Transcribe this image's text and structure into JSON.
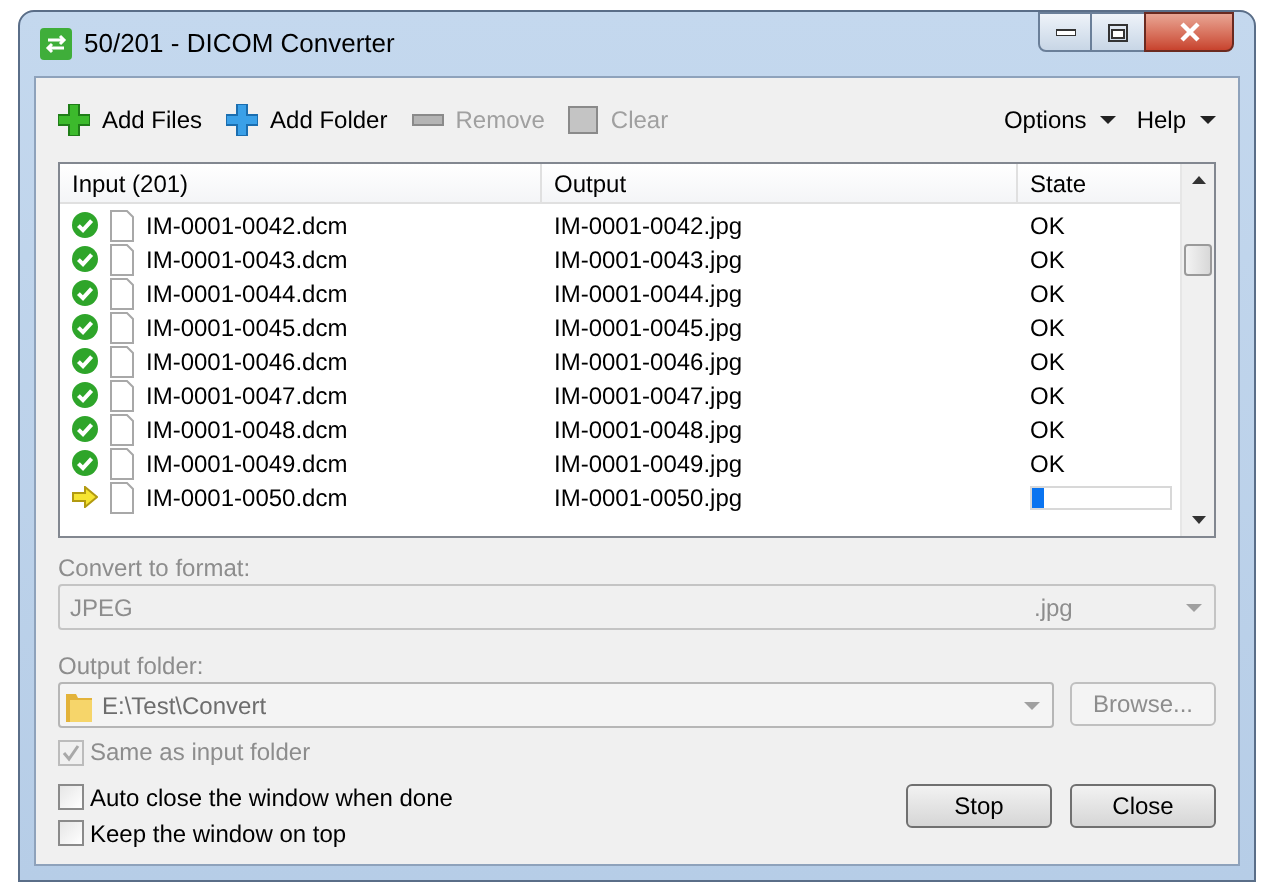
{
  "window": {
    "title": "50/201 - DICOM Converter"
  },
  "toolbar": {
    "left": [
      {
        "label": "Add Files",
        "kind": "add-files",
        "disabled": false
      },
      {
        "label": "Add Folder",
        "kind": "add-folder",
        "disabled": false
      },
      {
        "label": "Remove",
        "kind": "remove",
        "disabled": true
      },
      {
        "label": "Clear",
        "kind": "clear",
        "disabled": true
      }
    ],
    "right": [
      {
        "label": "Options"
      },
      {
        "label": "Help"
      }
    ]
  },
  "table": {
    "columns": [
      "Input (201)",
      "Output",
      "State"
    ],
    "rows": [
      {
        "kind": "done",
        "input": "IM-0001-0042.dcm",
        "output": "IM-0001-0042.jpg",
        "state": "OK"
      },
      {
        "kind": "done",
        "input": "IM-0001-0043.dcm",
        "output": "IM-0001-0043.jpg",
        "state": "OK"
      },
      {
        "kind": "done",
        "input": "IM-0001-0044.dcm",
        "output": "IM-0001-0044.jpg",
        "state": "OK"
      },
      {
        "kind": "done",
        "input": "IM-0001-0045.dcm",
        "output": "IM-0001-0045.jpg",
        "state": "OK"
      },
      {
        "kind": "done",
        "input": "IM-0001-0046.dcm",
        "output": "IM-0001-0046.jpg",
        "state": "OK"
      },
      {
        "kind": "done",
        "input": "IM-0001-0047.dcm",
        "output": "IM-0001-0047.jpg",
        "state": "OK"
      },
      {
        "kind": "done",
        "input": "IM-0001-0048.dcm",
        "output": "IM-0001-0048.jpg",
        "state": "OK"
      },
      {
        "kind": "done",
        "input": "IM-0001-0049.dcm",
        "output": "IM-0001-0049.jpg",
        "state": "OK"
      },
      {
        "kind": "converting",
        "input": "IM-0001-0050.dcm",
        "output": "IM-0001-0050.jpg",
        "level": 0.08
      }
    ]
  },
  "format": {
    "label": "Convert to format:",
    "value": "JPEG",
    "extension": ".jpg",
    "disabled": true
  },
  "output_folder": {
    "label": "Output folder:",
    "value": "E:\\Test\\Convert",
    "browse": "Browse...",
    "browse_disabled": true,
    "same_as_input": {
      "label": "Same as input folder",
      "checked": true,
      "disabled": true
    }
  },
  "options": [
    {
      "label": "Auto close the window when done",
      "checked": false
    },
    {
      "label": "Keep the window on top",
      "checked": false
    }
  ],
  "buttons": [
    "Stop",
    "Close"
  ]
}
